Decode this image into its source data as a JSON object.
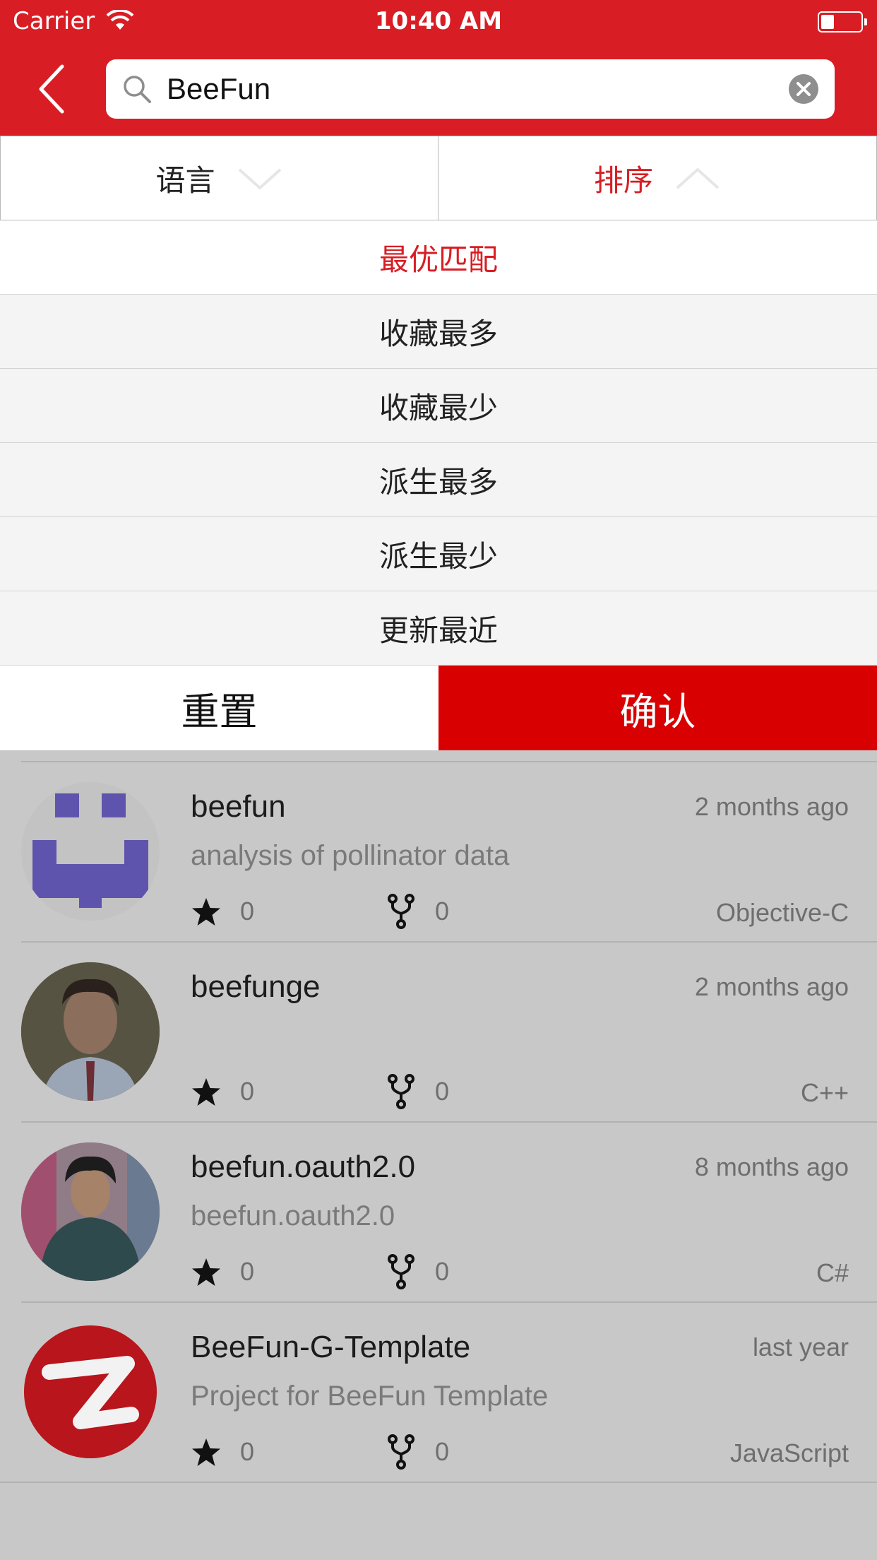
{
  "status_bar": {
    "carrier": "Carrier",
    "time": "10:40 AM"
  },
  "search": {
    "query": "BeeFun"
  },
  "filters": {
    "language_label": "语言",
    "sort_label": "排序",
    "active_tab": "sort"
  },
  "sort_options": [
    {
      "label": "最优匹配",
      "selected": true
    },
    {
      "label": "收藏最多",
      "selected": false
    },
    {
      "label": "收藏最少",
      "selected": false
    },
    {
      "label": "派生最多",
      "selected": false
    },
    {
      "label": "派生最少",
      "selected": false
    },
    {
      "label": "更新最近",
      "selected": false
    }
  ],
  "actions": {
    "reset_label": "重置",
    "confirm_label": "确认"
  },
  "results": [
    {
      "name": "beefun",
      "time": "2 months ago",
      "description": "analysis of pollinator data",
      "stars": "0",
      "forks": "0",
      "language": "Objective-C",
      "avatar": "pixel-identicon"
    },
    {
      "name": "beefunge",
      "time": "2 months ago",
      "description": "",
      "stars": "0",
      "forks": "0",
      "language": "C++",
      "avatar": "person-photo"
    },
    {
      "name": "beefun.oauth2.0",
      "time": "8 months ago",
      "description": "beefun.oauth2.0",
      "stars": "0",
      "forks": "0",
      "language": "C#",
      "avatar": "person-photo"
    },
    {
      "name": "BeeFun-G-Template",
      "time": "last year",
      "description": "Project for BeeFun Template",
      "stars": "0",
      "forks": "0",
      "language": "JavaScript",
      "avatar": "red-logo"
    }
  ],
  "colors": {
    "brand_red": "#d81e24",
    "confirm_red": "#d80000",
    "mask_gray": "#c8c8c8"
  }
}
